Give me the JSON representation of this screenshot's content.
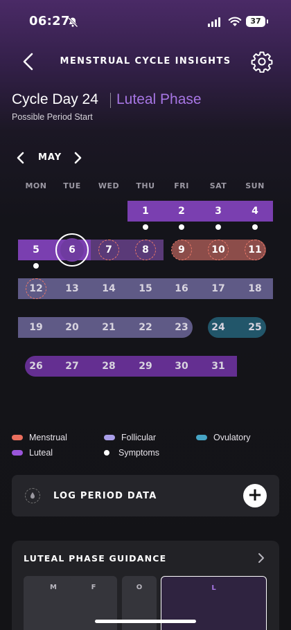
{
  "status_bar": {
    "time": "06:27",
    "battery": "37"
  },
  "header": {
    "title": "MENSTRUAL CYCLE INSIGHTS"
  },
  "summary": {
    "cycle_day": "Cycle Day 24",
    "phase": "Luteal Phase",
    "subtitle": "Possible Period Start"
  },
  "calendar": {
    "month": "MAY",
    "weekdays": [
      "MON",
      "TUE",
      "WED",
      "THU",
      "FRI",
      "SAT",
      "SUN"
    ],
    "today": "6",
    "days": [
      "1",
      "2",
      "3",
      "4",
      "5",
      "6",
      "7",
      "8",
      "9",
      "10",
      "11",
      "12",
      "13",
      "14",
      "15",
      "16",
      "17",
      "18",
      "19",
      "20",
      "21",
      "22",
      "23",
      "24",
      "25",
      "26",
      "27",
      "28",
      "29",
      "30",
      "31"
    ]
  },
  "legend": {
    "menstrual": "Menstrual",
    "follicular": "Follicular",
    "ovulatory": "Ovulatory",
    "luteal": "Luteal",
    "symptoms": "Symptoms"
  },
  "colors": {
    "luteal": "#7a3fb0",
    "menstrual": "#ea6f5e",
    "follicular": "#a99ee8",
    "ovulatory": "#46a4c4",
    "accent": "#a776e4"
  },
  "log_card": {
    "label": "LOG PERIOD DATA",
    "icon": "droplet-icon",
    "action_icon": "plus-icon"
  },
  "guidance": {
    "title": "LUTEAL PHASE GUIDANCE",
    "tabs": [
      "M",
      "F",
      "O",
      "L"
    ]
  }
}
